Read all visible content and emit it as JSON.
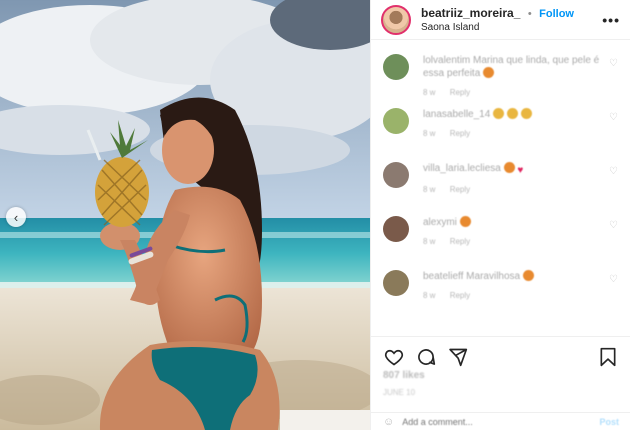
{
  "header": {
    "username": "beatriiz_moreira_",
    "separator": "•",
    "follow_label": "Follow",
    "location": "Saona Island",
    "more_label": "•••"
  },
  "photo": {
    "prev_label": "‹"
  },
  "comments": [
    {
      "user": "lolvalentim",
      "text": "lolvalentim Marina que linda, que pele é essa perfeita",
      "emoji": "orange",
      "time": "8 w",
      "reply": "Reply",
      "avatar_color": "#6e8f5a"
    },
    {
      "user": "lanasabelle_14",
      "text": "lanasabelle_14",
      "emoji": "yellow3",
      "time": "8 w",
      "reply": "Reply",
      "avatar_color": "#9ab36a"
    },
    {
      "user": "villa_laria",
      "text": "villa_laria.lecliesa",
      "emoji": "orange-heart",
      "time": "8 w",
      "reply": "Reply",
      "avatar_color": "#8b7a70"
    },
    {
      "user": "alexymi",
      "text": "alexymi",
      "emoji": "orange",
      "time": "8 w",
      "reply": "Reply",
      "avatar_color": "#7a5a4a"
    },
    {
      "user": "beatelieff",
      "text": "beatelieff Maravilhosa",
      "emoji": "orange",
      "time": "8 w",
      "reply": "Reply",
      "avatar_color": "#8a7a5a"
    }
  ],
  "footer": {
    "likes": "807 likes",
    "date": "JUNE 10",
    "add_comment_placeholder": "Add a comment...",
    "post_label": "Post"
  },
  "colors": {
    "accent": "#0095f6",
    "ring": "#e1306c"
  }
}
